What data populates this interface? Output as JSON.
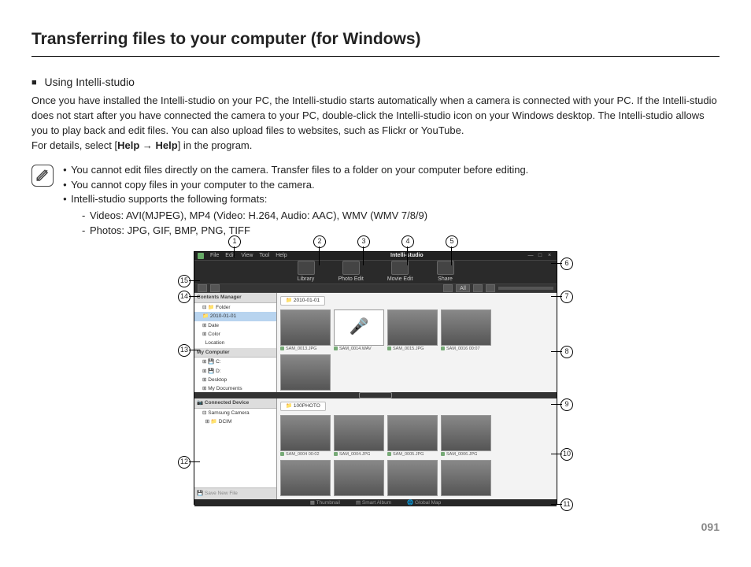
{
  "page_title": "Transferring files to your computer (for Windows)",
  "section_title": "Using Intelli-studio",
  "paragraph": "Once you have installed the Intelli-studio on your PC, the Intelli-studio starts automatically when a camera is connected with your PC. If the Intelli-studio does not start after you have connected the camera to your PC, double-click the Intelli-studio icon on your Windows desktop. The Intelli-studio allows you to play back and edit files. You can also upload files to websites, such as Flickr or YouTube.",
  "help_line_prefix": "For details, select [",
  "help_a": "Help",
  "help_arrow": "→",
  "help_b": "Help",
  "help_line_suffix": "] in the program.",
  "notes": [
    "You cannot edit files directly on the camera. Transfer files to a folder on your computer before editing.",
    "You cannot copy files in your computer to the camera.",
    "Intelli-studio supports the following formats:"
  ],
  "formats": [
    "Videos: AVI(MJPEG), MP4 (Video: H.264, Audio: AAC), WMV (WMV 7/8/9)",
    "Photos: JPG, GIF, BMP, PNG, TIFF"
  ],
  "app": {
    "menus": [
      "File",
      "Edit",
      "View",
      "Tool",
      "Help"
    ],
    "brand": "Intelli-studio",
    "win_controls": [
      "—",
      "□",
      "×"
    ],
    "toolbar": [
      "Library",
      "Photo Edit",
      "Movie Edit",
      "Share"
    ],
    "sidebar": {
      "contents_head": "Contents Manager",
      "folder": "Folder",
      "selected": "2010-01-01",
      "date": "Date",
      "color": "Color",
      "location": "Location",
      "mycomputer_head": "My Computer",
      "drives": [
        "C:",
        "D:",
        "Desktop",
        "My Documents"
      ]
    },
    "crumb": "2010-01-01",
    "thumbs": [
      "SAM_0013.JPG",
      "SAM_0014.WAV",
      "SAM_0015.JPG",
      "SAM_0016   00:07"
    ],
    "device_head": "Connected Device",
    "device_tree": [
      "Samsung Camera",
      "DCIM"
    ],
    "device_crumb": "100PHOTO",
    "dev_thumbs": [
      "SAM_0004   00:02",
      "SAM_0004.JPG",
      "SAM_0005.JPG",
      "SAM_0006.JPG"
    ],
    "save_new": "Save New File",
    "bottom_tabs": [
      "Thumbnail",
      "Smart Album",
      "Global Map"
    ],
    "view_all": "All"
  },
  "callouts": [
    "1",
    "2",
    "3",
    "4",
    "5",
    "6",
    "7",
    "8",
    "9",
    "10",
    "11",
    "12",
    "13",
    "14",
    "15"
  ],
  "page_number": "091"
}
